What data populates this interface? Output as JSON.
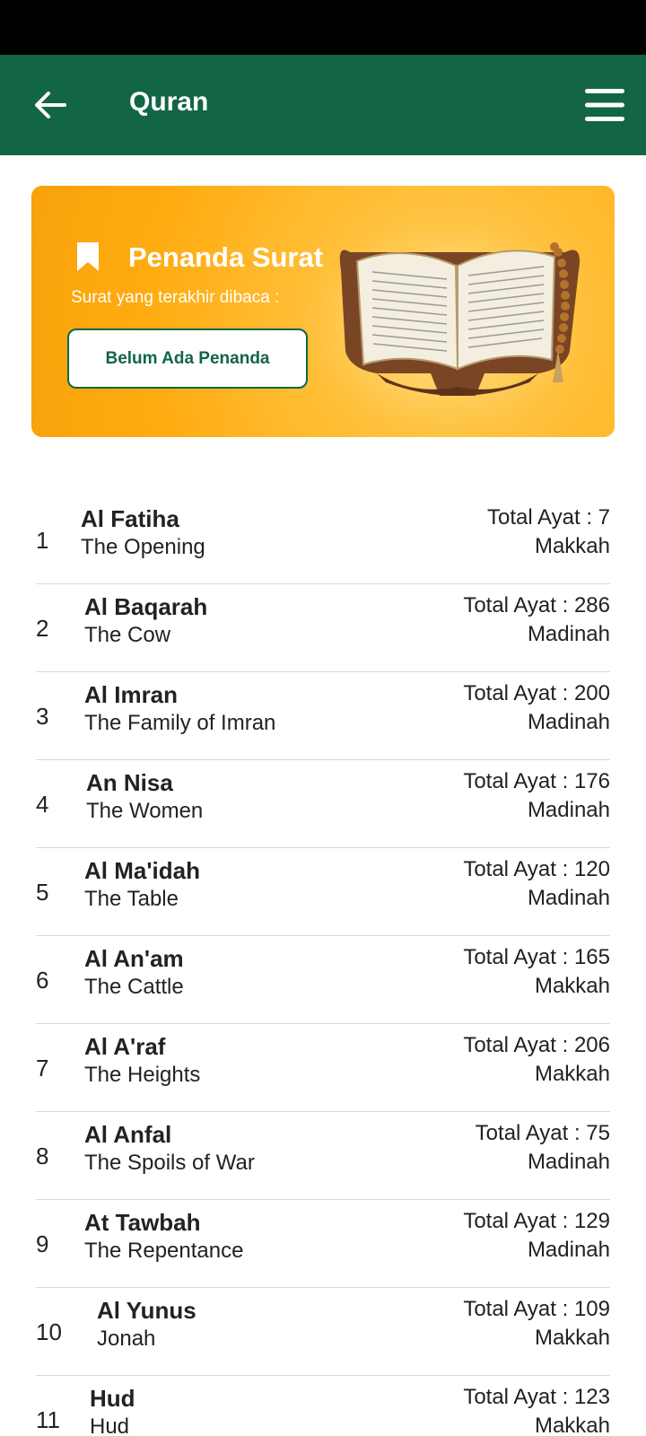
{
  "app_bar": {
    "title": "Quran",
    "back_icon": "arrow-left-icon",
    "menu_icon": "hamburger-menu-icon",
    "color": "#126545"
  },
  "bookmark_banner": {
    "title": "Penanda Surat",
    "subtitle": "Surat yang terakhir dibaca :",
    "button_label": "Belum Ada Penanda",
    "icon": "bookmark-icon",
    "image": "open-quran-on-stand-with-prayer-beads"
  },
  "surahs": [
    {
      "number": "1",
      "name": "Al Fatiha",
      "translation": "The Opening",
      "total": "Total Ayat : 7",
      "place": "Makkah"
    },
    {
      "number": "2",
      "name": "Al Baqarah",
      "translation": "The Cow",
      "total": "Total Ayat : 286",
      "place": "Madinah"
    },
    {
      "number": "3",
      "name": "Al Imran",
      "translation": "The Family of Imran",
      "total": "Total Ayat : 200",
      "place": "Madinah"
    },
    {
      "number": "4",
      "name": "An Nisa",
      "translation": "The Women",
      "total": "Total Ayat : 176",
      "place": "Madinah"
    },
    {
      "number": "5",
      "name": "Al Ma'idah",
      "translation": "The Table",
      "total": "Total Ayat : 120",
      "place": "Madinah"
    },
    {
      "number": "6",
      "name": "Al An'am",
      "translation": "The Cattle",
      "total": "Total Ayat : 165",
      "place": "Makkah"
    },
    {
      "number": "7",
      "name": "Al A'raf",
      "translation": "The Heights",
      "total": "Total Ayat : 206",
      "place": "Makkah"
    },
    {
      "number": "8",
      "name": "Al Anfal",
      "translation": "The Spoils of War",
      "total": "Total Ayat : 75",
      "place": "Madinah"
    },
    {
      "number": "9",
      "name": "At Tawbah",
      "translation": "The Repentance",
      "total": "Total Ayat : 129",
      "place": "Madinah"
    },
    {
      "number": "10",
      "name": "Al Yunus",
      "translation": "Jonah",
      "total": "Total Ayat : 109",
      "place": "Makkah"
    },
    {
      "number": "11",
      "name": "Hud",
      "translation": "Hud",
      "total": "Total Ayat : 123",
      "place": "Makkah"
    }
  ]
}
